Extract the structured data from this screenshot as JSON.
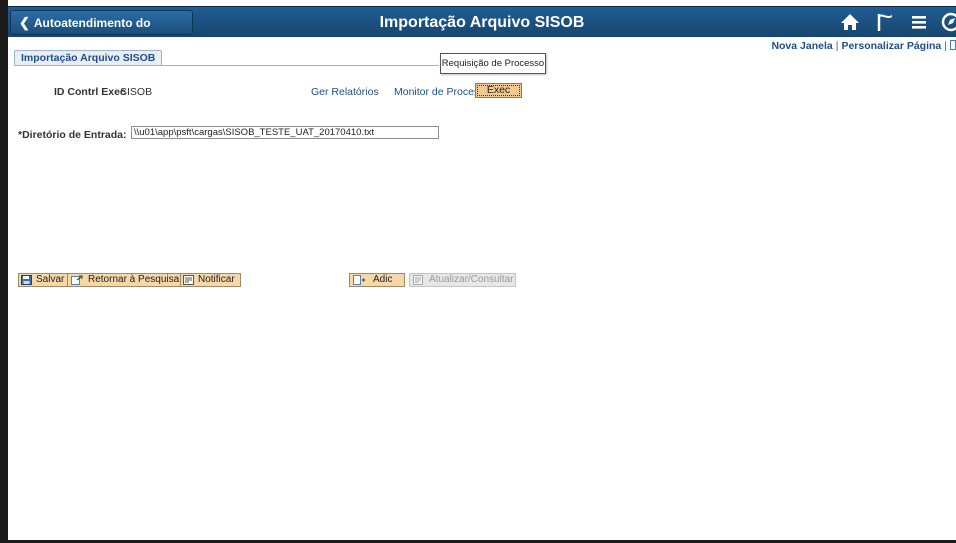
{
  "header": {
    "back_label": "Autoatendimento do Gerente",
    "title": "Importação Arquivo SISOB",
    "icons": [
      "home-icon",
      "flag-icon",
      "menu-icon",
      "navbar-icon"
    ]
  },
  "top_links": {
    "new_window": "Nova Janela",
    "personalize": "Personalizar Página"
  },
  "tab": {
    "label": "Importação Arquivo SISOB"
  },
  "tooltip": {
    "text": "Requisição de Processo"
  },
  "run_control": {
    "label": "ID Contrl Exec",
    "value": "SISOB",
    "report_manager": "Ger Relatórios",
    "process_monitor": "Monitor de Processos",
    "exec_label": "Exec"
  },
  "directory": {
    "label": "*Diretório de Entrada:",
    "value": "\\\\u01\\app\\psft\\cargas\\SISOB_TESTE_UAT_20170410.txt"
  },
  "toolbar": {
    "save": "Salvar",
    "return_search": "Retornar à Pesquisa",
    "notify": "Notificar",
    "add": "Adic",
    "update_display": "Atualizar/Consultar"
  },
  "colors": {
    "header_bg": "#1f5d94",
    "button_bg": "#f6d7a8",
    "link": "#1f4e8a"
  }
}
